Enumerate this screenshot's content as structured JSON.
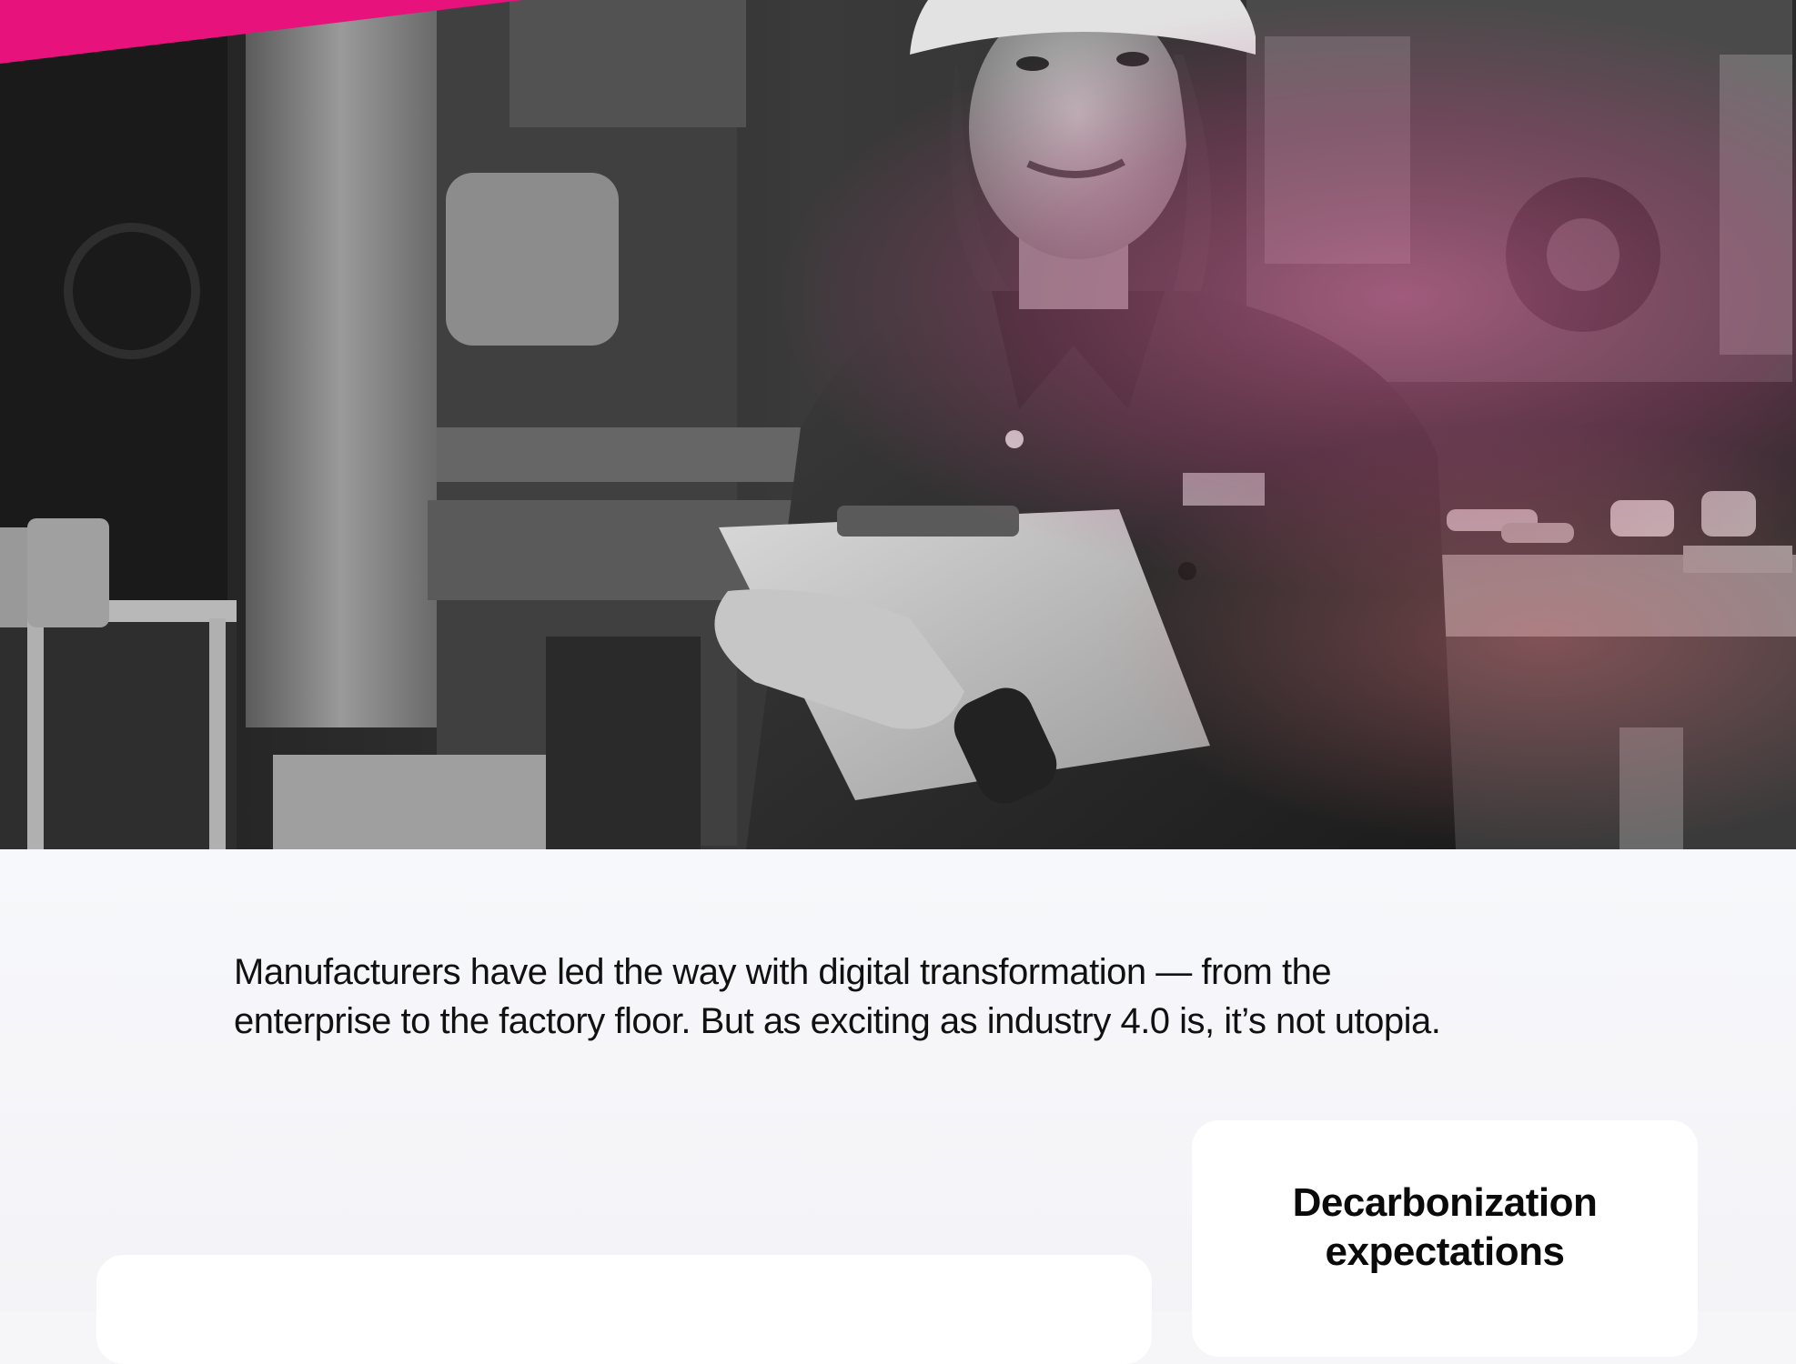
{
  "hero": {
    "banner_color": "#e8127c",
    "tint_color": "#e86aa6"
  },
  "intro": {
    "line1": "Manufacturers have led the way with digital transformation — from the",
    "line2": "enterprise to the factory floor. But as exciting as industry 4.0 is, it’s not utopia."
  },
  "cards": {
    "decarbonization": {
      "title_line1": "Decarbonization",
      "title_line2": "expectations"
    }
  }
}
